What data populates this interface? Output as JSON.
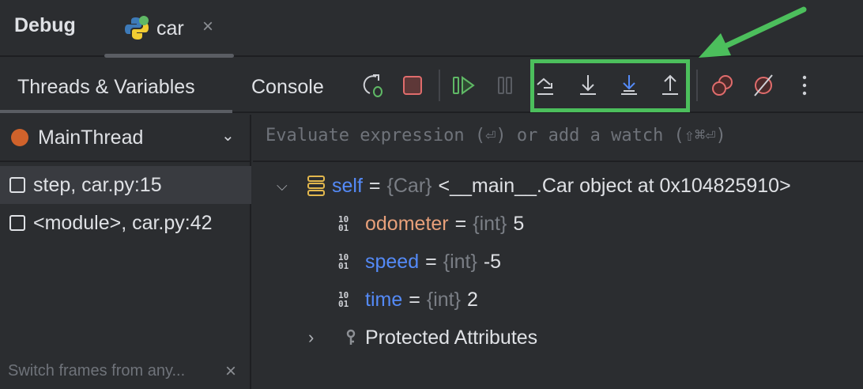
{
  "header": {
    "title": "Debug",
    "tab_label": "car",
    "close": "×"
  },
  "toolbar": {
    "tabs": [
      "Threads & Variables",
      "Console"
    ],
    "icons": [
      "rerun-debug-icon",
      "stop-icon",
      "resume-icon",
      "pause-icon",
      "step-over-icon",
      "step-into-icon",
      "step-into-my-code-icon",
      "step-out-icon",
      "view-breakpoints-icon",
      "mute-breakpoints-icon",
      "more-icon"
    ]
  },
  "threads": {
    "selected": "MainThread",
    "frames": [
      "step, car.py:15",
      "<module>, car.py:42"
    ],
    "hint": "Switch frames from any...",
    "hint_close": "×"
  },
  "evaluate": {
    "placeholder": "Evaluate expression (⏎) or add a watch (⇧⌘⏎)"
  },
  "variables": {
    "self": {
      "name": "self",
      "eq": "=",
      "type": "{Car}",
      "value": "<__main__.Car object at 0x104825910>"
    },
    "children": [
      {
        "name": "odometer",
        "eq": "=",
        "type": "{int}",
        "value": "5",
        "color": "#e8a07a"
      },
      {
        "name": "speed",
        "eq": "=",
        "type": "{int}",
        "value": "-5",
        "color": "#548af7"
      },
      {
        "name": "time",
        "eq": "=",
        "type": "{int}",
        "value": "2",
        "color": "#548af7"
      }
    ],
    "protected": "Protected Attributes"
  },
  "colors": {
    "annotation": "#4cbf5c",
    "accent": "#548af7",
    "stop": "#e06c6c"
  }
}
